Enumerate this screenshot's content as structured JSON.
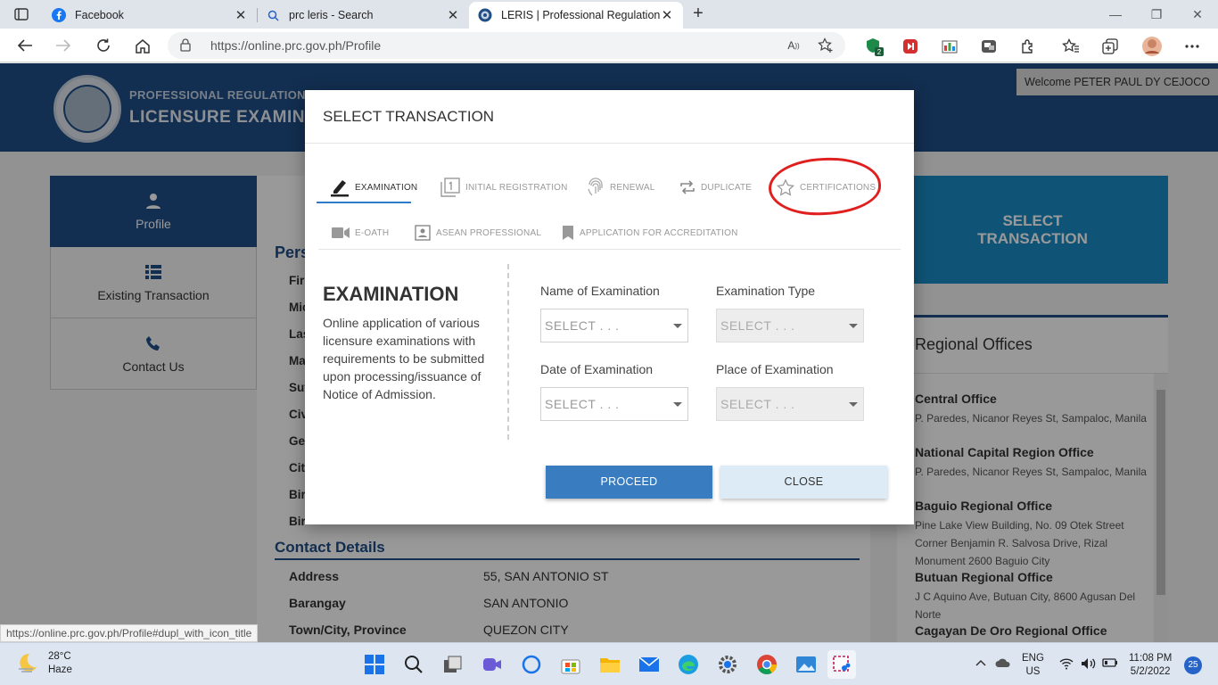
{
  "browser": {
    "tabs": [
      {
        "title": "Facebook"
      },
      {
        "title": "prc leris - Search"
      },
      {
        "title": "LERIS | Professional Regulation C"
      }
    ],
    "url": "https://online.prc.gov.ph/Profile",
    "status_url": "https://online.prc.gov.ph/Profile#dupl_with_icon_title",
    "ext_badge": "2"
  },
  "site": {
    "org_line1": "PROFESSIONAL REGULATION C",
    "org_line2": "LICENSURE EXAMINAT",
    "welcome": "Welcome PETER PAUL DY CEJOCO"
  },
  "sidenav": {
    "items": [
      {
        "label": "Profile"
      },
      {
        "label": "Existing Transaction"
      },
      {
        "label": "Contact Us"
      }
    ]
  },
  "profile": {
    "personal_heading": "Pers",
    "partial_labels": [
      "Fir",
      "Mic",
      "Las",
      "Ma",
      "Suf",
      "Civ",
      "Ge",
      "Cit",
      "Bir",
      "Bir"
    ],
    "contact_heading": "Contact Details",
    "contact_rows": [
      {
        "label": "Address",
        "value": "55, SAN ANTONIO ST"
      },
      {
        "label": "Barangay",
        "value": "SAN ANTONIO"
      },
      {
        "label": "Town/City, Province",
        "value": "QUEZON CITY"
      }
    ]
  },
  "select_tile": {
    "line1": "SELECT",
    "line2": "TRANSACTION"
  },
  "regional": {
    "title": "Regional Offices",
    "offices": [
      {
        "name": "Central Office",
        "address": "P. Paredes, Nicanor Reyes St, Sampaloc, Manila"
      },
      {
        "name": "National Capital Region Office",
        "address": "P. Paredes, Nicanor Reyes St, Sampaloc, Manila"
      },
      {
        "name": "Baguio Regional Office",
        "address": "Pine Lake View Building, No. 09 Otek Street Corner Benjamin R. Salvosa Drive, Rizal Monument 2600 Baguio City"
      },
      {
        "name": "Butuan Regional Office",
        "address": "J C Aquino Ave, Butuan City, 8600 Agusan Del Norte"
      },
      {
        "name": "Cagayan De Oro Regional Office",
        "address": ""
      }
    ]
  },
  "modal": {
    "title": "SELECT TRANSACTION",
    "tabs": [
      {
        "label": "EXAMINATION"
      },
      {
        "label": "INITIAL REGISTRATION"
      },
      {
        "label": "RENEWAL"
      },
      {
        "label": "DUPLICATE"
      },
      {
        "label": "CERTIFICATIONS"
      },
      {
        "label": "E-OATH"
      },
      {
        "label": "ASEAN PROFESSIONAL"
      },
      {
        "label": "APPLICATION FOR ACCREDITATION"
      }
    ],
    "active_tab": "EXAMINATION",
    "section_title": "EXAMINATION",
    "section_desc": "Online application of various licensure examinations with requirements to be submitted upon processing/issuance of Notice of Admission.",
    "fields": [
      {
        "label": "Name of Examination",
        "value": "SELECT . . .",
        "disabled": false
      },
      {
        "label": "Examination Type",
        "value": "SELECT . . .",
        "disabled": true
      },
      {
        "label": "Date of Examination",
        "value": "SELECT . . .",
        "disabled": false
      },
      {
        "label": "Place of Examination",
        "value": "SELECT . . .",
        "disabled": true
      }
    ],
    "proceed_label": "PROCEED",
    "close_label": "CLOSE"
  },
  "taskbar": {
    "weather_temp": "28°C",
    "weather_desc": "Haze",
    "lang1": "ENG",
    "lang2": "US",
    "time": "11:08 PM",
    "date": "5/2/2022",
    "notifications": "25"
  },
  "colors": {
    "header_blue": "#1f4e85",
    "tile_blue": "#1a8dc5",
    "proceed_blue": "#3a7cc0",
    "annotation_red": "#e0201f"
  }
}
